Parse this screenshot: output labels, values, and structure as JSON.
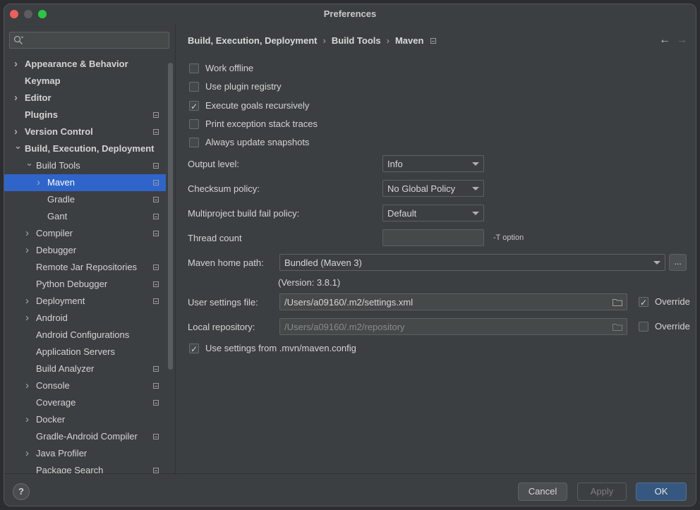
{
  "window": {
    "title": "Preferences"
  },
  "sidebar": {
    "search_placeholder": "",
    "items": [
      {
        "label": "Appearance & Behavior",
        "bold": true,
        "level": 0,
        "chevron": "right",
        "project": false
      },
      {
        "label": "Keymap",
        "bold": true,
        "level": 0,
        "chevron": "none",
        "project": false
      },
      {
        "label": "Editor",
        "bold": true,
        "level": 0,
        "chevron": "right",
        "project": false
      },
      {
        "label": "Plugins",
        "bold": true,
        "level": 0,
        "chevron": "none",
        "project": true
      },
      {
        "label": "Version Control",
        "bold": true,
        "level": 0,
        "chevron": "right",
        "project": true
      },
      {
        "label": "Build, Execution, Deployment",
        "bold": true,
        "level": 0,
        "chevron": "down",
        "project": false
      },
      {
        "label": "Build Tools",
        "bold": false,
        "level": 1,
        "chevron": "down",
        "project": true
      },
      {
        "label": "Maven",
        "bold": false,
        "level": 2,
        "chevron": "right",
        "project": true,
        "selected": true
      },
      {
        "label": "Gradle",
        "bold": false,
        "level": 2,
        "chevron": "none",
        "project": true
      },
      {
        "label": "Gant",
        "bold": false,
        "level": 2,
        "chevron": "none",
        "project": true
      },
      {
        "label": "Compiler",
        "bold": false,
        "level": 1,
        "chevron": "right",
        "project": true
      },
      {
        "label": "Debugger",
        "bold": false,
        "level": 1,
        "chevron": "right",
        "project": false
      },
      {
        "label": "Remote Jar Repositories",
        "bold": false,
        "level": 1,
        "chevron": "none",
        "project": true
      },
      {
        "label": "Python Debugger",
        "bold": false,
        "level": 1,
        "chevron": "none",
        "project": true
      },
      {
        "label": "Deployment",
        "bold": false,
        "level": 1,
        "chevron": "right",
        "project": true
      },
      {
        "label": "Android",
        "bold": false,
        "level": 1,
        "chevron": "right",
        "project": false
      },
      {
        "label": "Android Configurations",
        "bold": false,
        "level": 1,
        "chevron": "none",
        "project": false
      },
      {
        "label": "Application Servers",
        "bold": false,
        "level": 1,
        "chevron": "none",
        "project": false
      },
      {
        "label": "Build Analyzer",
        "bold": false,
        "level": 1,
        "chevron": "none",
        "project": true
      },
      {
        "label": "Console",
        "bold": false,
        "level": 1,
        "chevron": "right",
        "project": true
      },
      {
        "label": "Coverage",
        "bold": false,
        "level": 1,
        "chevron": "none",
        "project": true
      },
      {
        "label": "Docker",
        "bold": false,
        "level": 1,
        "chevron": "right",
        "project": false
      },
      {
        "label": "Gradle-Android Compiler",
        "bold": false,
        "level": 1,
        "chevron": "none",
        "project": true
      },
      {
        "label": "Java Profiler",
        "bold": false,
        "level": 1,
        "chevron": "right",
        "project": false
      },
      {
        "label": "Package Search",
        "bold": false,
        "level": 1,
        "chevron": "none",
        "project": true
      }
    ]
  },
  "breadcrumb": {
    "part1": "Build, Execution, Deployment",
    "part2": "Build Tools",
    "part3": "Maven",
    "sep": "›"
  },
  "nav": {
    "back": "←",
    "forward": "→"
  },
  "options": {
    "work_offline": {
      "label": "Work offline",
      "checked": false
    },
    "use_plugin_registry": {
      "label": "Use plugin registry",
      "checked": false
    },
    "execute_goals": {
      "label": "Execute goals recursively",
      "checked": true
    },
    "print_exception": {
      "label": "Print exception stack traces",
      "checked": false
    },
    "always_update": {
      "label": "Always update snapshots",
      "checked": false
    },
    "use_mvn_config": {
      "label": "Use settings from .mvn/maven.config",
      "checked": true
    }
  },
  "fields": {
    "output_level": {
      "label": "Output level:",
      "value": "Info"
    },
    "checksum_policy": {
      "label": "Checksum policy:",
      "value": "No Global Policy"
    },
    "multiproject_policy": {
      "label": "Multiproject build fail policy:",
      "value": "Default"
    },
    "thread_count": {
      "label": "Thread count",
      "value": "",
      "hint": "-T option"
    },
    "maven_home": {
      "label": "Maven home path:",
      "value": "Bundled (Maven 3)",
      "version": "(Version: 3.8.1)",
      "browse": "..."
    },
    "user_settings": {
      "label": "User settings file:",
      "value": "/Users/a09160/.m2/settings.xml",
      "override_label": "Override",
      "override_checked": true
    },
    "local_repo": {
      "label": "Local repository:",
      "value": "/Users/a09160/.m2/repository",
      "override_label": "Override",
      "override_checked": false
    }
  },
  "footer": {
    "help": "?",
    "cancel": "Cancel",
    "apply": "Apply",
    "ok": "OK"
  },
  "colors": {
    "selection": "#2f65ca",
    "ok_button": "#365880",
    "background": "#3c3f41"
  }
}
